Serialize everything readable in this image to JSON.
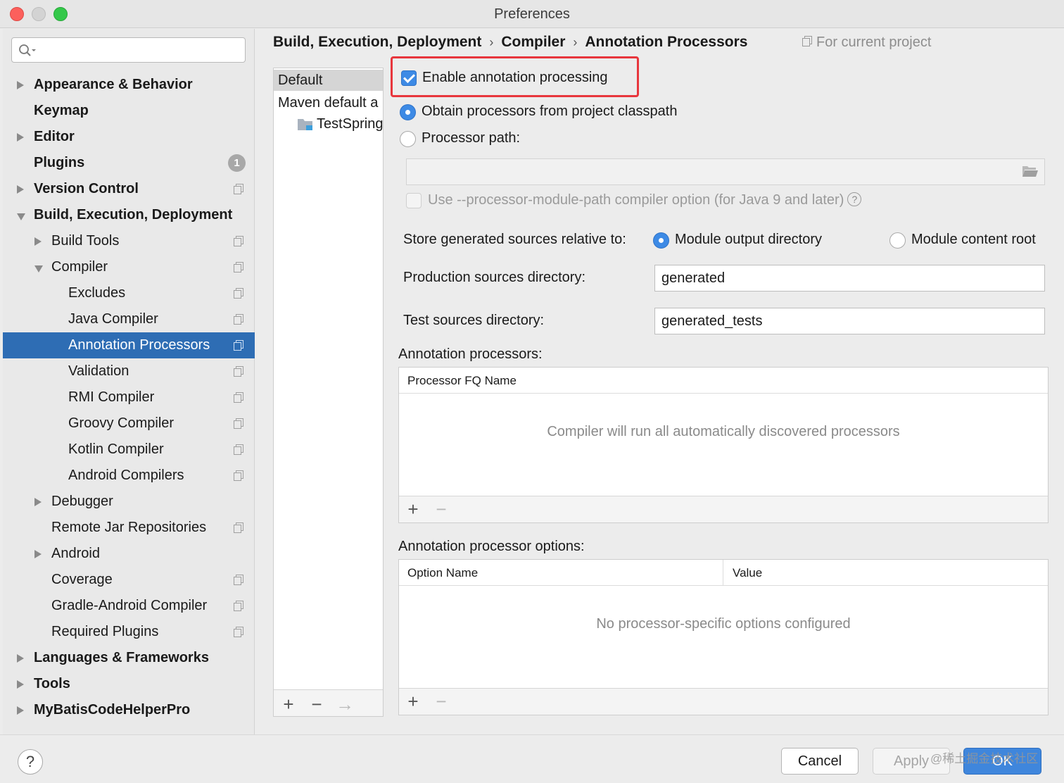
{
  "window": {
    "title": "Preferences"
  },
  "sidebar": {
    "search": {
      "value": "",
      "placeholder": ""
    },
    "items": [
      {
        "label": "Appearance & Behavior",
        "level": 0,
        "arrow": "right",
        "bold": true,
        "icon": ""
      },
      {
        "label": "Keymap",
        "level": 0,
        "arrow": "",
        "bold": true,
        "icon": ""
      },
      {
        "label": "Editor",
        "level": 0,
        "arrow": "right",
        "bold": true,
        "icon": ""
      },
      {
        "label": "Plugins",
        "level": 0,
        "arrow": "",
        "bold": true,
        "icon": "badge",
        "badge": "1"
      },
      {
        "label": "Version Control",
        "level": 0,
        "arrow": "right",
        "bold": true,
        "icon": "copy"
      },
      {
        "label": "Build, Execution, Deployment",
        "level": 0,
        "arrow": "down",
        "bold": true,
        "icon": ""
      },
      {
        "label": "Build Tools",
        "level": 1,
        "arrow": "right",
        "bold": false,
        "icon": "copy"
      },
      {
        "label": "Compiler",
        "level": 1,
        "arrow": "down",
        "bold": false,
        "icon": "copy"
      },
      {
        "label": "Excludes",
        "level": 2,
        "arrow": "",
        "bold": false,
        "icon": "copy"
      },
      {
        "label": "Java Compiler",
        "level": 2,
        "arrow": "",
        "bold": false,
        "icon": "copy"
      },
      {
        "label": "Annotation Processors",
        "level": 2,
        "arrow": "",
        "bold": false,
        "icon": "copy",
        "selected": true
      },
      {
        "label": "Validation",
        "level": 2,
        "arrow": "",
        "bold": false,
        "icon": "copy"
      },
      {
        "label": "RMI Compiler",
        "level": 2,
        "arrow": "",
        "bold": false,
        "icon": "copy"
      },
      {
        "label": "Groovy Compiler",
        "level": 2,
        "arrow": "",
        "bold": false,
        "icon": "copy"
      },
      {
        "label": "Kotlin Compiler",
        "level": 2,
        "arrow": "",
        "bold": false,
        "icon": "copy"
      },
      {
        "label": "Android Compilers",
        "level": 2,
        "arrow": "",
        "bold": false,
        "icon": "copy"
      },
      {
        "label": "Debugger",
        "level": 1,
        "arrow": "right",
        "bold": false,
        "icon": ""
      },
      {
        "label": "Remote Jar Repositories",
        "level": 1,
        "arrow": "",
        "bold": false,
        "icon": "copy"
      },
      {
        "label": "Android",
        "level": 1,
        "arrow": "right",
        "bold": false,
        "icon": ""
      },
      {
        "label": "Coverage",
        "level": 1,
        "arrow": "",
        "bold": false,
        "icon": "copy"
      },
      {
        "label": "Gradle-Android Compiler",
        "level": 1,
        "arrow": "",
        "bold": false,
        "icon": "copy"
      },
      {
        "label": "Required Plugins",
        "level": 1,
        "arrow": "",
        "bold": false,
        "icon": "copy"
      },
      {
        "label": "Languages & Frameworks",
        "level": 0,
        "arrow": "right",
        "bold": true,
        "icon": ""
      },
      {
        "label": "Tools",
        "level": 0,
        "arrow": "right",
        "bold": true,
        "icon": ""
      },
      {
        "label": "MyBatisCodeHelperPro",
        "level": 0,
        "arrow": "right",
        "bold": true,
        "icon": ""
      }
    ]
  },
  "breadcrumb": {
    "parts": [
      "Build, Execution, Deployment",
      "Compiler",
      "Annotation Processors"
    ],
    "separator": "›",
    "scope": "For current project"
  },
  "profiles": {
    "items": [
      {
        "label": "Default",
        "selected": true,
        "indent": false
      },
      {
        "label": "Maven default a",
        "selected": false,
        "indent": false
      },
      {
        "label": "TestSpring",
        "selected": false,
        "indent": true
      }
    ],
    "toolbar": {
      "add": "+",
      "remove": "−",
      "move": "→"
    }
  },
  "options": {
    "enable_annotation_processing": {
      "label": "Enable annotation processing",
      "checked": true
    },
    "obtain_from_classpath": {
      "label": "Obtain processors from project classpath",
      "checked": true
    },
    "processor_path": {
      "label": "Processor path:",
      "checked": false,
      "value": ""
    },
    "use_module_path": {
      "label": "Use --processor-module-path compiler option (for Java 9 and later)",
      "checked": false,
      "help": "?"
    },
    "store_generated": {
      "label": "Store generated sources relative to:",
      "module_output": "Module output directory",
      "module_content": "Module content root",
      "selected": "module_output"
    },
    "production_dir": {
      "label": "Production sources directory:",
      "value": "generated"
    },
    "test_dir": {
      "label": "Test sources directory:",
      "value": "generated_tests"
    }
  },
  "processors_table": {
    "label": "Annotation processors:",
    "columns": [
      "Processor FQ Name"
    ],
    "empty_text": "Compiler will run all automatically discovered processors",
    "toolbar": {
      "add": "+",
      "remove": "−"
    }
  },
  "options_table": {
    "label": "Annotation processor options:",
    "columns": [
      "Option Name",
      "Value"
    ],
    "empty_text": "No processor-specific options configured",
    "toolbar": {
      "add": "+",
      "remove": "−"
    }
  },
  "buttons": {
    "help": "?",
    "cancel": "Cancel",
    "apply": "Apply",
    "ok": "OK"
  },
  "watermark": "@稀土掘金技术社区",
  "colors": {
    "selection": "#2e6db4",
    "accent": "#3d8ae5",
    "highlight_border": "#e8363d"
  }
}
